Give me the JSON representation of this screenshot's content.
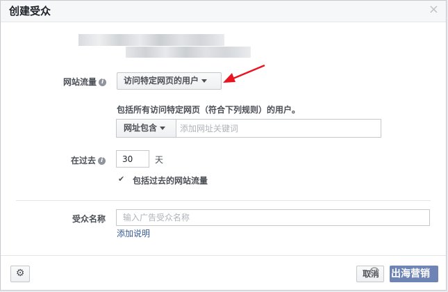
{
  "dialog": {
    "title": "创建受众",
    "close_glyph": "×"
  },
  "traffic": {
    "label": "网站流量",
    "info_glyph": "i",
    "selected_option": "访问特定网页的用户"
  },
  "rule": {
    "description": "包括所有访问特定网页（符合下列规则）的用户。",
    "condition": "网址包含",
    "keyword_placeholder": "添加网址关键词"
  },
  "period": {
    "label": "在过去",
    "info_glyph": "i",
    "days_value": "30",
    "unit": "天"
  },
  "include_past": {
    "checked_glyph": "✔",
    "label": "包括过去的网站流量"
  },
  "audience_name": {
    "label": "受众名称",
    "placeholder": "输入广告受众名称",
    "add_description_link": "添加说明"
  },
  "footer": {
    "cancel_label": "取消",
    "gear_glyph": "⚙"
  },
  "watermark": {
    "logo_glyph": "☊",
    "text": "出海营销"
  },
  "colors": {
    "link": "#365899",
    "arrow": "#e8141f",
    "watermark_bg": "#6d84b4"
  }
}
